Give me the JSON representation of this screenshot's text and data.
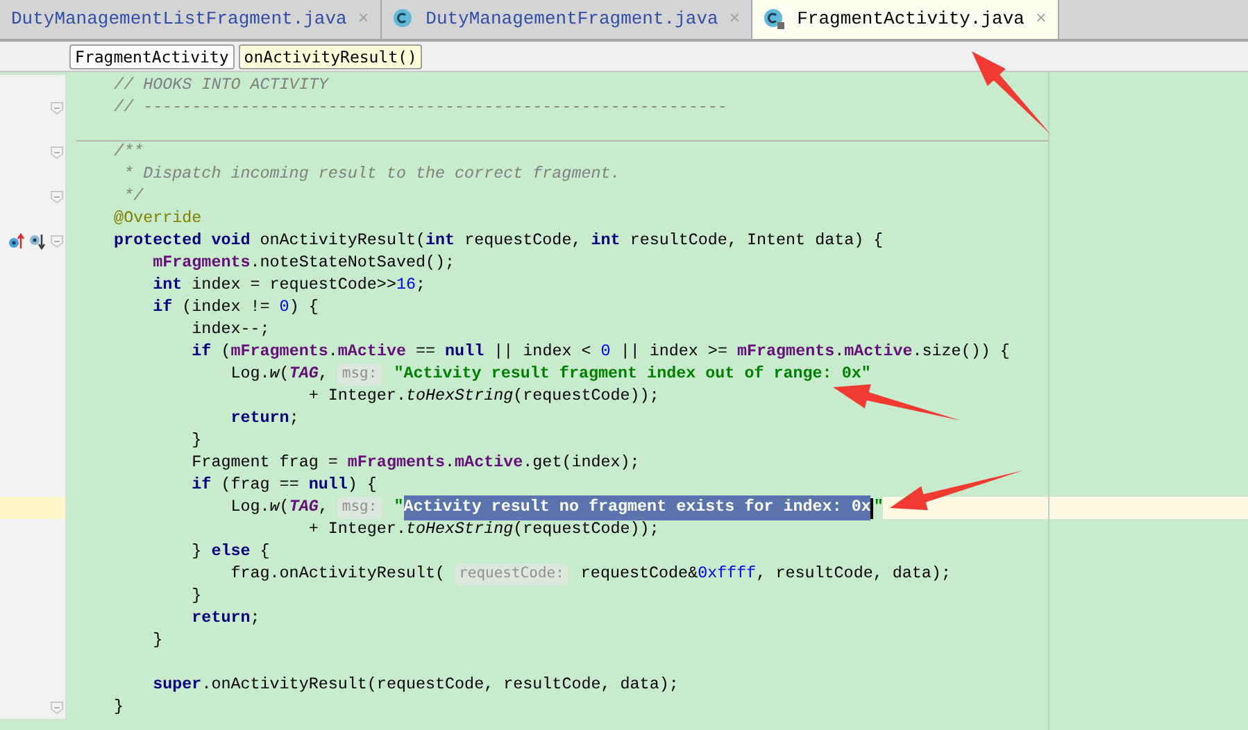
{
  "tabs": [
    {
      "label": "DutyManagementListFragment.java",
      "kind": "plain",
      "selected": false,
      "close": "×"
    },
    {
      "label": "DutyManagementFragment.java",
      "kind": "class",
      "selected": false,
      "close": "×"
    },
    {
      "label": "FragmentActivity.java",
      "kind": "locked_class",
      "selected": true,
      "close": "×"
    }
  ],
  "breadcrumbs": [
    {
      "label": "FragmentActivity",
      "selected": false
    },
    {
      "label": "onActivityResult()",
      "selected": true
    }
  ],
  "code_lines": [
    {
      "kind": "code",
      "current": false,
      "fold": false,
      "override_markers": false,
      "tokens": [
        {
          "kind": "comment",
          "text": "    // HOOKS INTO ACTIVITY"
        }
      ]
    },
    {
      "kind": "code",
      "current": false,
      "fold": true,
      "override_markers": false,
      "tokens": [
        {
          "kind": "comment",
          "text": "    // ------------------------------------------------------------"
        }
      ]
    },
    {
      "kind": "code",
      "current": false,
      "fold": false,
      "override_markers": false
    },
    {
      "kind": "separator"
    },
    {
      "kind": "code",
      "current": false,
      "fold": true,
      "override_markers": false,
      "tokens": [
        {
          "kind": "comment",
          "text": "    /**"
        }
      ]
    },
    {
      "kind": "code",
      "current": false,
      "fold": false,
      "override_markers": false,
      "tokens": [
        {
          "kind": "comment",
          "text": "     * Dispatch incoming result to the correct fragment."
        }
      ]
    },
    {
      "kind": "code",
      "current": false,
      "fold": true,
      "override_markers": false,
      "tokens": [
        {
          "kind": "comment",
          "text": "     */"
        }
      ]
    },
    {
      "kind": "code",
      "current": false,
      "fold": false,
      "override_markers": false,
      "tokens": [
        {
          "kind": "annotation",
          "text": "    @Override"
        }
      ]
    },
    {
      "kind": "code",
      "current": false,
      "fold": true,
      "override_markers": true,
      "tokens": [
        {
          "kind": "keyword",
          "text": "    protected void "
        },
        {
          "kind": "plain",
          "text": "onActivityResult("
        },
        {
          "kind": "keyword",
          "text": "int "
        },
        {
          "kind": "plain",
          "text": "requestCode, "
        },
        {
          "kind": "keyword",
          "text": "int "
        },
        {
          "kind": "plain",
          "text": "resultCode, Intent data) {"
        }
      ]
    },
    {
      "kind": "code",
      "current": false,
      "tokens": [
        {
          "kind": "field",
          "text": "        mFragments"
        },
        {
          "kind": "plain",
          "text": ".noteStateNotSaved();"
        }
      ]
    },
    {
      "kind": "code",
      "current": false,
      "tokens": [
        {
          "kind": "keyword",
          "text": "        int "
        },
        {
          "kind": "plain",
          "text": "index = requestCode>>"
        },
        {
          "kind": "number",
          "text": "16"
        },
        {
          "kind": "plain",
          "text": ";"
        }
      ]
    },
    {
      "kind": "code",
      "current": false,
      "tokens": [
        {
          "kind": "keyword",
          "text": "        if "
        },
        {
          "kind": "plain",
          "text": "(index != "
        },
        {
          "kind": "number",
          "text": "0"
        },
        {
          "kind": "plain",
          "text": ") {"
        }
      ]
    },
    {
      "kind": "code",
      "current": false,
      "tokens": [
        {
          "kind": "plain",
          "text": "            index--;"
        }
      ]
    },
    {
      "kind": "code",
      "current": false,
      "tokens": [
        {
          "kind": "keyword",
          "text": "            if "
        },
        {
          "kind": "plain",
          "text": "("
        },
        {
          "kind": "field",
          "text": "mFragments"
        },
        {
          "kind": "plain",
          "text": "."
        },
        {
          "kind": "field",
          "text": "mActive "
        },
        {
          "kind": "plain",
          "text": "== "
        },
        {
          "kind": "keyword",
          "text": "null "
        },
        {
          "kind": "plain",
          "text": "|| index < "
        },
        {
          "kind": "number",
          "text": "0 "
        },
        {
          "kind": "plain",
          "text": "|| index >= "
        },
        {
          "kind": "field",
          "text": "mFragments"
        },
        {
          "kind": "plain",
          "text": "."
        },
        {
          "kind": "field",
          "text": "mActive"
        },
        {
          "kind": "plain",
          "text": ".size()) {"
        }
      ]
    },
    {
      "kind": "code",
      "current": false,
      "tokens": [
        {
          "kind": "plain",
          "text": "                Log."
        },
        {
          "kind": "static_method",
          "text": "w"
        },
        {
          "kind": "plain",
          "text": "("
        },
        {
          "kind": "constant",
          "text": "TAG"
        },
        {
          "kind": "plain",
          "text": ", "
        },
        {
          "kind": "hint",
          "text": "msg:"
        },
        {
          "kind": "string",
          "text": " \"Activity result fragment index out of range: 0x\""
        }
      ]
    },
    {
      "kind": "code",
      "current": false,
      "tokens": [
        {
          "kind": "plain",
          "text": "                        + Integer."
        },
        {
          "kind": "static_method",
          "text": "toHexString"
        },
        {
          "kind": "plain",
          "text": "(requestCode));"
        }
      ]
    },
    {
      "kind": "code",
      "current": false,
      "tokens": [
        {
          "kind": "keyword",
          "text": "                return"
        },
        {
          "kind": "plain",
          "text": ";"
        }
      ]
    },
    {
      "kind": "code",
      "current": false,
      "tokens": [
        {
          "kind": "plain",
          "text": "            }"
        }
      ]
    },
    {
      "kind": "code",
      "current": false,
      "tokens": [
        {
          "kind": "plain",
          "text": "            Fragment frag = "
        },
        {
          "kind": "field",
          "text": "mFragments"
        },
        {
          "kind": "plain",
          "text": "."
        },
        {
          "kind": "field",
          "text": "mActive"
        },
        {
          "kind": "plain",
          "text": ".get(index);"
        }
      ]
    },
    {
      "kind": "code",
      "current": false,
      "tokens": [
        {
          "kind": "keyword",
          "text": "            if "
        },
        {
          "kind": "plain",
          "text": "(frag == "
        },
        {
          "kind": "keyword",
          "text": "null"
        },
        {
          "kind": "plain",
          "text": ") {"
        }
      ]
    },
    {
      "kind": "code",
      "current": true,
      "tokens": [
        {
          "kind": "plain",
          "text": "                Log."
        },
        {
          "kind": "static_method",
          "text": "w"
        },
        {
          "kind": "plain",
          "text": "("
        },
        {
          "kind": "constant",
          "text": "TAG"
        },
        {
          "kind": "plain",
          "text": ", "
        },
        {
          "kind": "hint",
          "text": "msg:"
        },
        {
          "kind": "string",
          "text": " \""
        },
        {
          "kind": "selected",
          "text": "Activity result no fragment exists for index: 0x"
        },
        {
          "kind": "caret"
        },
        {
          "kind": "string",
          "text": "\""
        }
      ]
    },
    {
      "kind": "code",
      "current": false,
      "tokens": [
        {
          "kind": "plain",
          "text": "                        + Integer."
        },
        {
          "kind": "static_method",
          "text": "toHexString"
        },
        {
          "kind": "plain",
          "text": "(requestCode));"
        }
      ]
    },
    {
      "kind": "code",
      "current": false,
      "tokens": [
        {
          "kind": "plain",
          "text": "            } "
        },
        {
          "kind": "keyword",
          "text": "else "
        },
        {
          "kind": "plain",
          "text": "{"
        }
      ]
    },
    {
      "kind": "code",
      "current": false,
      "tokens": [
        {
          "kind": "plain",
          "text": "                frag.onActivityResult( "
        },
        {
          "kind": "hint",
          "text": "requestCode:"
        },
        {
          "kind": "plain",
          "text": " requestCode&"
        },
        {
          "kind": "number",
          "text": "0xffff"
        },
        {
          "kind": "plain",
          "text": ", resultCode, data);"
        }
      ]
    },
    {
      "kind": "code",
      "current": false,
      "tokens": [
        {
          "kind": "plain",
          "text": "            }"
        }
      ]
    },
    {
      "kind": "code",
      "current": false,
      "tokens": [
        {
          "kind": "keyword",
          "text": "            return"
        },
        {
          "kind": "plain",
          "text": ";"
        }
      ]
    },
    {
      "kind": "code",
      "current": false,
      "tokens": [
        {
          "kind": "plain",
          "text": "        }"
        }
      ]
    },
    {
      "kind": "code",
      "current": false,
      "fold": false,
      "override_markers": false
    },
    {
      "kind": "code",
      "current": false,
      "fold": false,
      "override_markers": false,
      "tokens": [
        {
          "kind": "keyword",
          "text": "        super"
        },
        {
          "kind": "plain",
          "text": ".onActivityResult(requestCode, resultCode, data);"
        }
      ]
    },
    {
      "kind": "code",
      "current": false,
      "fold": true,
      "override_markers": false,
      "tokens": [
        {
          "kind": "plain",
          "text": "    }"
        }
      ]
    }
  ]
}
